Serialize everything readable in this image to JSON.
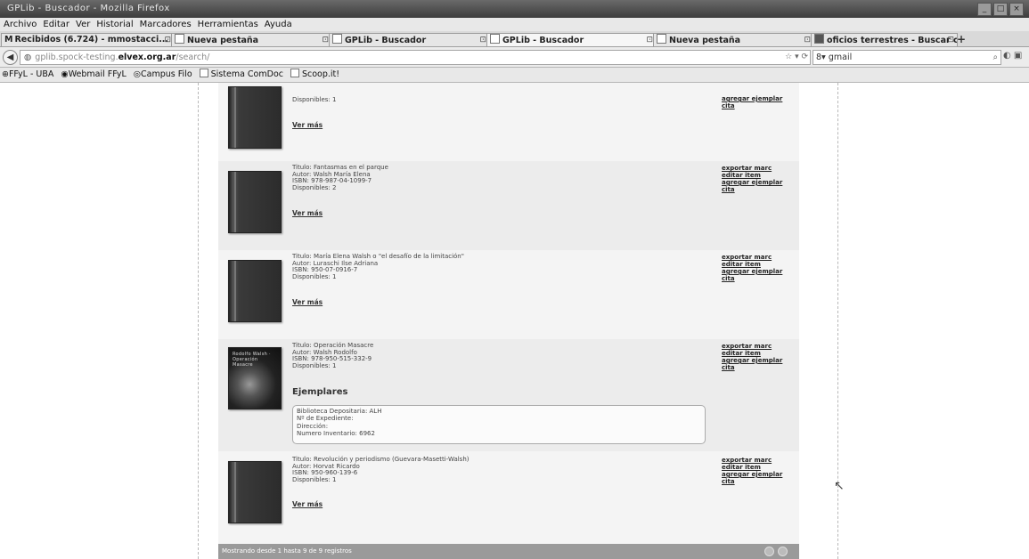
{
  "window": {
    "title": "GPLib - Buscador - Mozilla Firefox",
    "buttons": [
      "_",
      "□",
      "×"
    ]
  },
  "menu": [
    "Archivo",
    "Editar",
    "Ver",
    "Historial",
    "Marcadores",
    "Herramientas",
    "Ayuda"
  ],
  "tabs": [
    {
      "label": "Recibidos (6.724) - mmostacci..."
    },
    {
      "label": "Nueva pestaña"
    },
    {
      "label": "GPLib - Buscador"
    },
    {
      "label": "GPLib - Buscador"
    },
    {
      "label": "Nueva pestaña"
    },
    {
      "label": "oficios terrestres - Buscar con ..."
    }
  ],
  "navbar": {
    "url_prefix": "gplib.spock-testing.",
    "url_domain": "elvex.org.ar",
    "url_path": "/search/",
    "search_value": "gmail"
  },
  "bookmarks": [
    "FFyL - UBA",
    "Webmail FFyL",
    "Campus Filo",
    "Sistema ComDoc",
    "Scoop.it!"
  ],
  "results": [
    {
      "lines": [
        "Disponibles: 1"
      ],
      "ver_mas": "Ver más",
      "actions": [
        "agregar ejemplar",
        "cita"
      ]
    },
    {
      "lines": [
        "Titulo: Fantasmas en el parque",
        "Autor: Walsh María Elena",
        "ISBN: 978-987-04-1099-7",
        "Disponibles: 2"
      ],
      "ver_mas": "Ver más",
      "actions": [
        "exportar marc",
        "editar item",
        "agregar ejemplar",
        "cita"
      ]
    },
    {
      "lines": [
        "Titulo: María Elena Walsh o \"el desafío de la limitación\"",
        "Autor: Luraschi Ilse Adriana",
        "ISBN: 950-07-0916-7",
        "Disponibles: 1"
      ],
      "ver_mas": "Ver más",
      "actions": [
        "exportar marc",
        "editar item",
        "agregar ejemplar",
        "cita"
      ]
    },
    {
      "lines": [
        "Titulo: Operación Masacre",
        "Autor: Walsh Rodolfo",
        "ISBN: 978-950-515-332-9",
        "Disponibles: 1"
      ],
      "ejemplares_title": "Ejemplares",
      "ejemplar": [
        "Biblioteca Depositaria: ALH",
        "Nº de Expediente:",
        "Dirección:",
        "Numero Inventario: 6962"
      ],
      "cover_text": "Rodolfo Walsh · Operación Masacre",
      "actions": [
        "exportar marc",
        "editar item",
        "agregar ejemplar",
        "cita"
      ]
    },
    {
      "lines": [
        "Titulo: Revolución y periodismo (Guevara-Masetti-Walsh)",
        "Autor: Horvat Ricardo",
        "ISBN: 950-960-139-6",
        "Disponibles: 1"
      ],
      "ver_mas": "Ver más",
      "actions": [
        "exportar marc",
        "editar item",
        "agregar ejemplar",
        "cita"
      ]
    }
  ],
  "footer": {
    "text": "Mostrando desde 1 hasta 9 de 9 registros"
  }
}
